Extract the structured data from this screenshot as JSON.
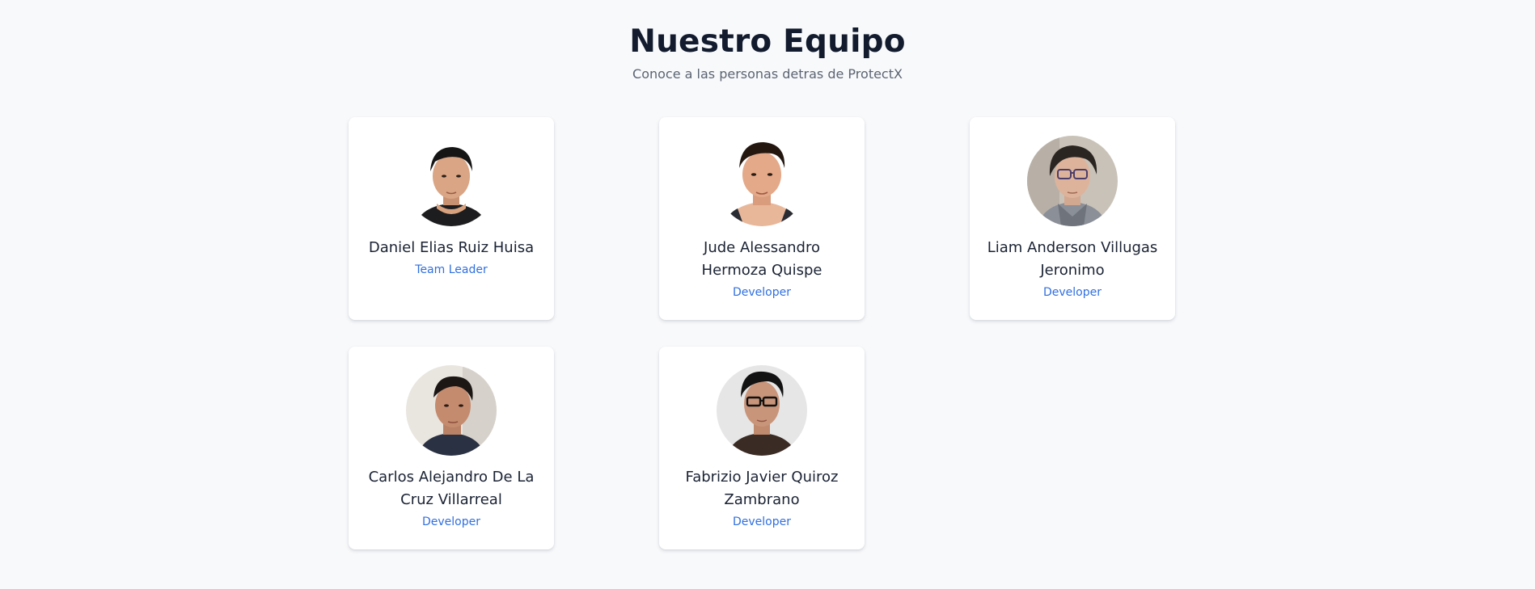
{
  "header": {
    "title": "Nuestro Equipo",
    "subtitle": "Conoce a las personas detras de ProtectX"
  },
  "team": [
    {
      "name": "Daniel Elias Ruiz Huisa",
      "role": "Team Leader"
    },
    {
      "name": "Jude Alessandro Hermoza Quispe",
      "role": "Developer"
    },
    {
      "name": "Liam Anderson Villugas Jeronimo",
      "role": "Developer"
    },
    {
      "name": "Carlos Alejandro De La Cruz Villarreal",
      "role": "Developer"
    },
    {
      "name": "Fabrizio Javier Quiroz Zambrano",
      "role": "Developer"
    }
  ],
  "colors": {
    "page_background": "#f8f9fb",
    "title": "#131c2e",
    "subtitle": "#5b6472",
    "role_accent": "#2f6fe0",
    "card_background": "#ffffff"
  }
}
